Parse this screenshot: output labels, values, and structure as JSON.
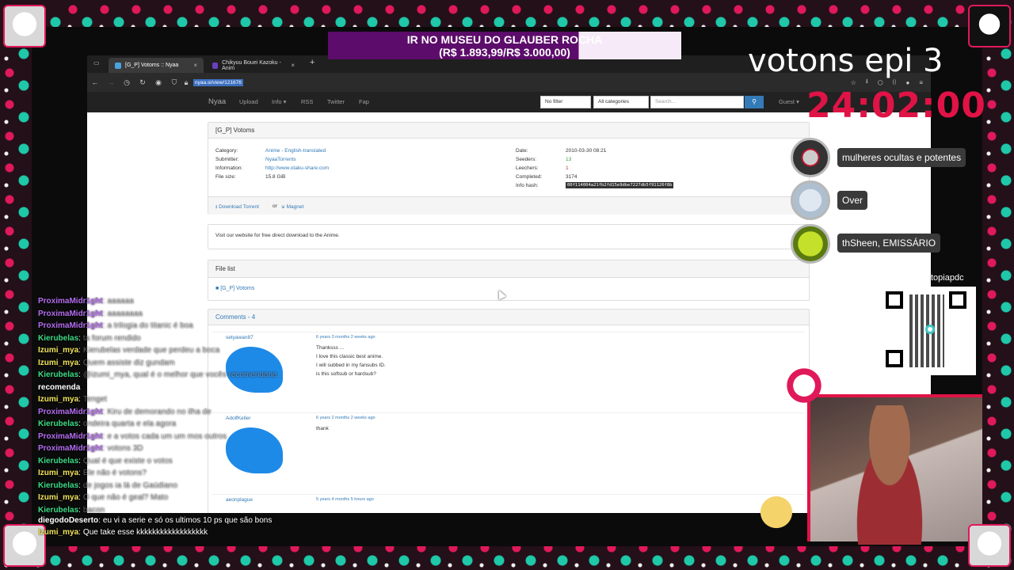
{
  "browser": {
    "tabs": [
      {
        "label": "[G_P] Votoms :: Nyaa",
        "close": "×"
      },
      {
        "label": "Chikyuu Bouei Kazoku - Anim",
        "close": "×"
      }
    ],
    "new_tab": "+",
    "url": "nyaa.si/view/121676"
  },
  "site": {
    "brand": "Nyaa",
    "nav": [
      "Upload",
      "Info ▾",
      "RSS",
      "Twitter",
      "Fap"
    ],
    "filter_select": "No filter",
    "category_select": "All categories",
    "search_placeholder": "Search...",
    "guest": "Guest ▾"
  },
  "torrent": {
    "title": "[G_P] Votoms",
    "left": [
      {
        "label": "Category:",
        "value": "Anime - English-translated"
      },
      {
        "label": "Submitter:",
        "value": "NyaaTorrents"
      },
      {
        "label": "Information:",
        "value": "http://www.otaku-share.com"
      },
      {
        "label": "File size:",
        "value": "15.8 GiB"
      }
    ],
    "right": [
      {
        "label": "Date:",
        "value": "2010-03-30 08:21"
      },
      {
        "label": "Seeders:",
        "value": "13"
      },
      {
        "label": "Leechers:",
        "value": "1"
      },
      {
        "label": "Completed:",
        "value": "3174"
      },
      {
        "label": "Info hash:",
        "value": "00f114004a21fb2fd15e9dbe7227db5f91126f8b"
      }
    ],
    "download_torrent": "Download Torrent",
    "or": "or",
    "magnet": "Magnet",
    "description": "Visit our website for free direct download to the Anime.",
    "file_list_title": "File list",
    "folder": "[G_P] Votoms",
    "comments_title": "Comments - 4",
    "comments": [
      {
        "user": "setyawan87",
        "date": "6 years 3 months 2 weeks ago",
        "lines": [
          "Thanksss ...",
          "I love this classic best anime.",
          "I will subbed in my fansubs ID.",
          "is this softsub or hardsub?"
        ]
      },
      {
        "user": "AdolfKeller",
        "date": "6 years 2 months 2 weeks ago",
        "lines": [
          "thank"
        ]
      },
      {
        "user": "aeonplague",
        "date": "5 years 4 months 5 hours ago",
        "lines": []
      }
    ]
  },
  "stream": {
    "donation_line1": "IR NO MUSEU DO GLAUBER ROCHA",
    "donation_line2": "(R$ 1.893,99/R$ 3.000,00)",
    "episode_title": "votons epi 3",
    "timer": "24:02:00",
    "viewers": [
      {
        "name": "mulheres ocultas e potentes"
      },
      {
        "name": "Over"
      },
      {
        "name": "thSheen, EMISSÁRIO"
      }
    ],
    "livepix": "livepix.gg/distopiapdc"
  },
  "chat": {
    "lines": [
      {
        "user": "ProximaMidr1ght",
        "color": "#b46cf0",
        "msg": "aaaaaa"
      },
      {
        "user": "ProximaMidr1ght",
        "color": "#b46cf0",
        "msg": "aaaaaaaa"
      },
      {
        "user": "ProximaMidr1ght",
        "color": "#b46cf0",
        "msg": "a trilogia do titanic é boa"
      },
      {
        "user": "Kierubelas",
        "color": "#3ddc84",
        "msg": "ta forum rendido"
      },
      {
        "user": "Izumi_mya",
        "color": "#f2e35a",
        "msg": "Kierubelas verdade que perdeu a boca"
      },
      {
        "user": "Izumi_mya",
        "color": "#f2e35a",
        "msg": "Quem assiste diz gundam"
      },
      {
        "user": "Kierubelas",
        "color": "#3ddc84",
        "msg": "@izumi_mya, qual é o melhor que vocês recomendaria"
      },
      {
        "user": "recomenda",
        "color": "#ffffff",
        "msg": ""
      },
      {
        "user": "Izumi_mya",
        "color": "#f2e35a",
        "msg": "Tenget"
      },
      {
        "user": "ProximaMidr1ght",
        "color": "#b46cf0",
        "msg": "Kiru de demorando no ilha de"
      },
      {
        "user": "Kierubelas",
        "color": "#3ddc84",
        "msg": "ondeira quarta e ela agora"
      },
      {
        "user": "ProximaMidr1ght",
        "color": "#b46cf0",
        "msg": "e a votos cada um um mos outros"
      },
      {
        "user": "ProximaMidr1ght",
        "color": "#b46cf0",
        "msg": "votons 3D"
      },
      {
        "user": "Kierubelas",
        "color": "#3ddc84",
        "msg": "Qual é que existe o votos"
      },
      {
        "user": "Izumi_mya",
        "color": "#f2e35a",
        "msg": "Ele não é votons?"
      },
      {
        "user": "Kierubelas",
        "color": "#3ddc84",
        "msg": "de jogos ia lá de Gaúdiano"
      },
      {
        "user": "Izumi_mya",
        "color": "#f2e35a",
        "msg": "O que não é geal? Mato"
      },
      {
        "user": "Kierubelas",
        "color": "#3ddc84",
        "msg": "bacon"
      }
    ],
    "bottom": [
      {
        "user": "diegodoDeserto",
        "color": "#ffffff",
        "msg": "eu vi a serie e só os ultimos 10 ps que são bons"
      },
      {
        "user": "Izumi_mya",
        "color": "#f2e35a",
        "msg": "Que take esse kkkkkkkkkkkkkkkkkk"
      }
    ]
  }
}
